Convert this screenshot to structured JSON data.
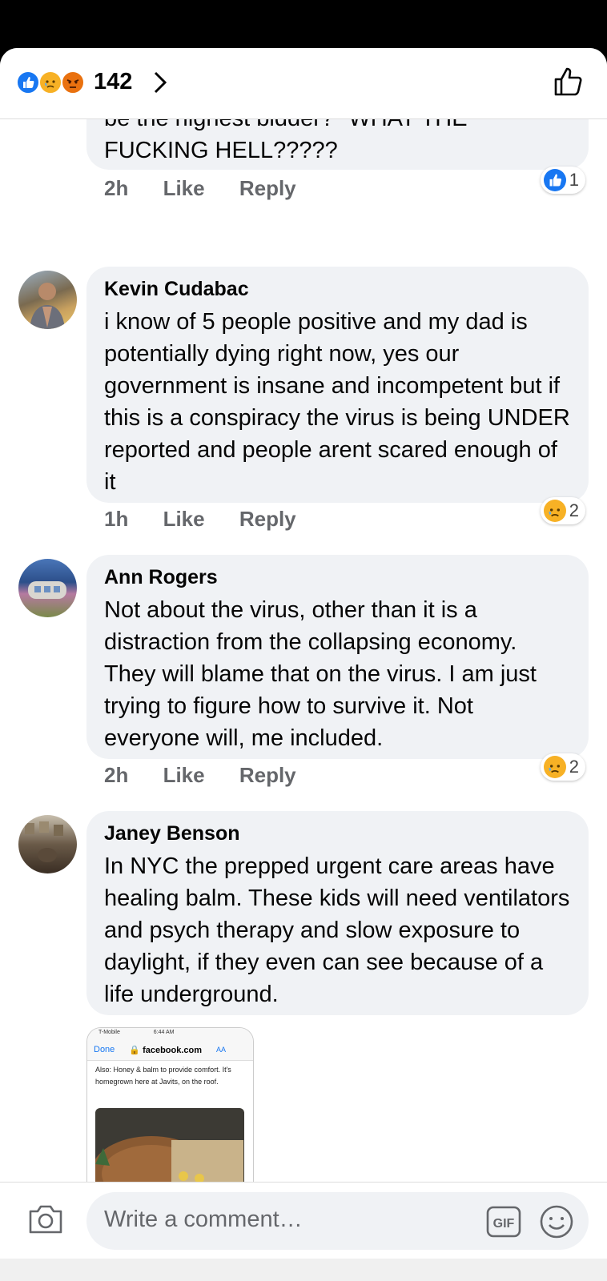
{
  "header": {
    "reaction_count": "142",
    "reactions": [
      "like-icon",
      "sad-icon",
      "angry-icon"
    ]
  },
  "comments": [
    {
      "author": "",
      "text_lines": [
        "be the highest bidder?\" WHAT THE",
        "FUCKING HELL?????"
      ],
      "time": "2h",
      "like": "Like",
      "reply": "Reply",
      "reaction": "like-icon",
      "reaction_count": "1"
    },
    {
      "author": "Kevin Cudabac",
      "text": "i know of 5 people positive and my dad is potentially dying right now, yes our government is insane and incompetent but if this is a conspiracy the virus is being UNDER reported and people arent scared enough of it",
      "time": "1h",
      "like": "Like",
      "reply": "Reply",
      "reaction": "sad-icon",
      "reaction_count": "2"
    },
    {
      "author": "Ann Rogers",
      "text": "Not about the virus, other than it is a distraction from the collapsing economy. They will blame that on the virus. I am just trying to figure how to survive it. Not everyone will, me included.",
      "time": "2h",
      "like": "Like",
      "reply": "Reply",
      "reaction": "sad-icon",
      "reaction_count": "2"
    },
    {
      "author": "Janey Benson",
      "text": "In NYC the prepped urgent care areas have healing balm. These kids will need ventilators and psych therapy and slow exposure to daylight, if they even can see because of a life underground.",
      "attachment": {
        "carrier": "T-Mobile",
        "clock": "6:44 AM",
        "done": "Done",
        "url": "facebook.com",
        "aa": "AA",
        "caption": "Also: Honey & balm to provide comfort. It's homegrown here at Javits, on the roof."
      }
    }
  ],
  "composer": {
    "placeholder": "Write a comment…",
    "gif": "GIF"
  },
  "colors": {
    "like_blue": "#1877f2",
    "sad_yellow": "#f7b125",
    "angry_orange": "#e9710f",
    "bubble_bg": "#f0f2f5",
    "meta_gray": "#65676b"
  }
}
